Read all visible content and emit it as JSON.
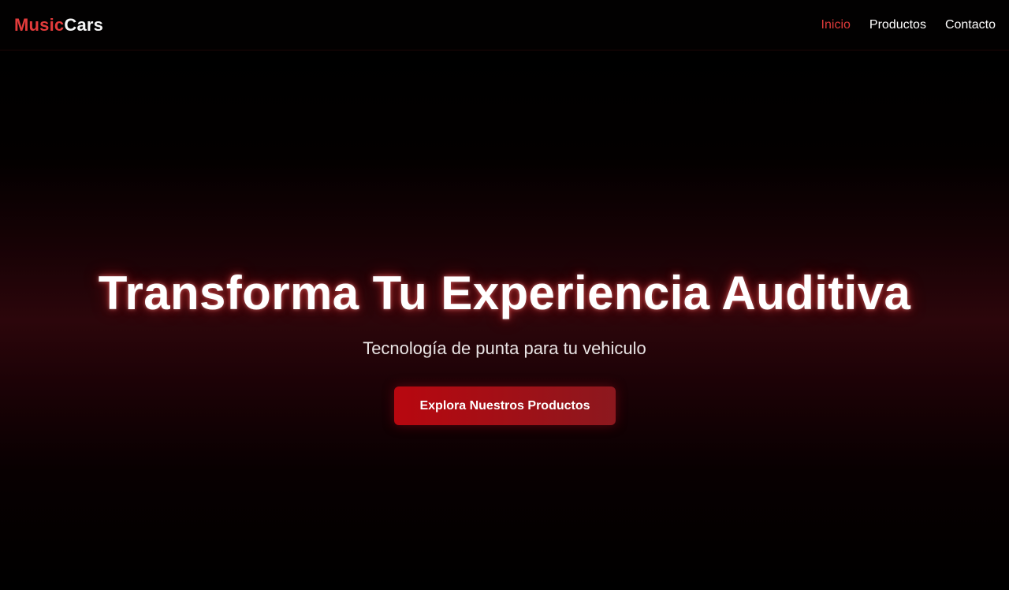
{
  "brand": {
    "name_part1": "Music",
    "name_part2": "Cars"
  },
  "nav": {
    "items": [
      {
        "label": "Inicio",
        "active": true
      },
      {
        "label": "Productos",
        "active": false
      },
      {
        "label": "Contacto",
        "active": false
      }
    ]
  },
  "hero": {
    "title": "Transforma Tu Experiencia Auditiva",
    "subtitle": "Tecnología de punta para tu vehiculo",
    "cta_label": "Explora Nuestros Productos"
  },
  "colors": {
    "accent": "#e03a3a",
    "button_start": "#b8070f",
    "button_end": "#8c181e",
    "background": "#000000"
  }
}
